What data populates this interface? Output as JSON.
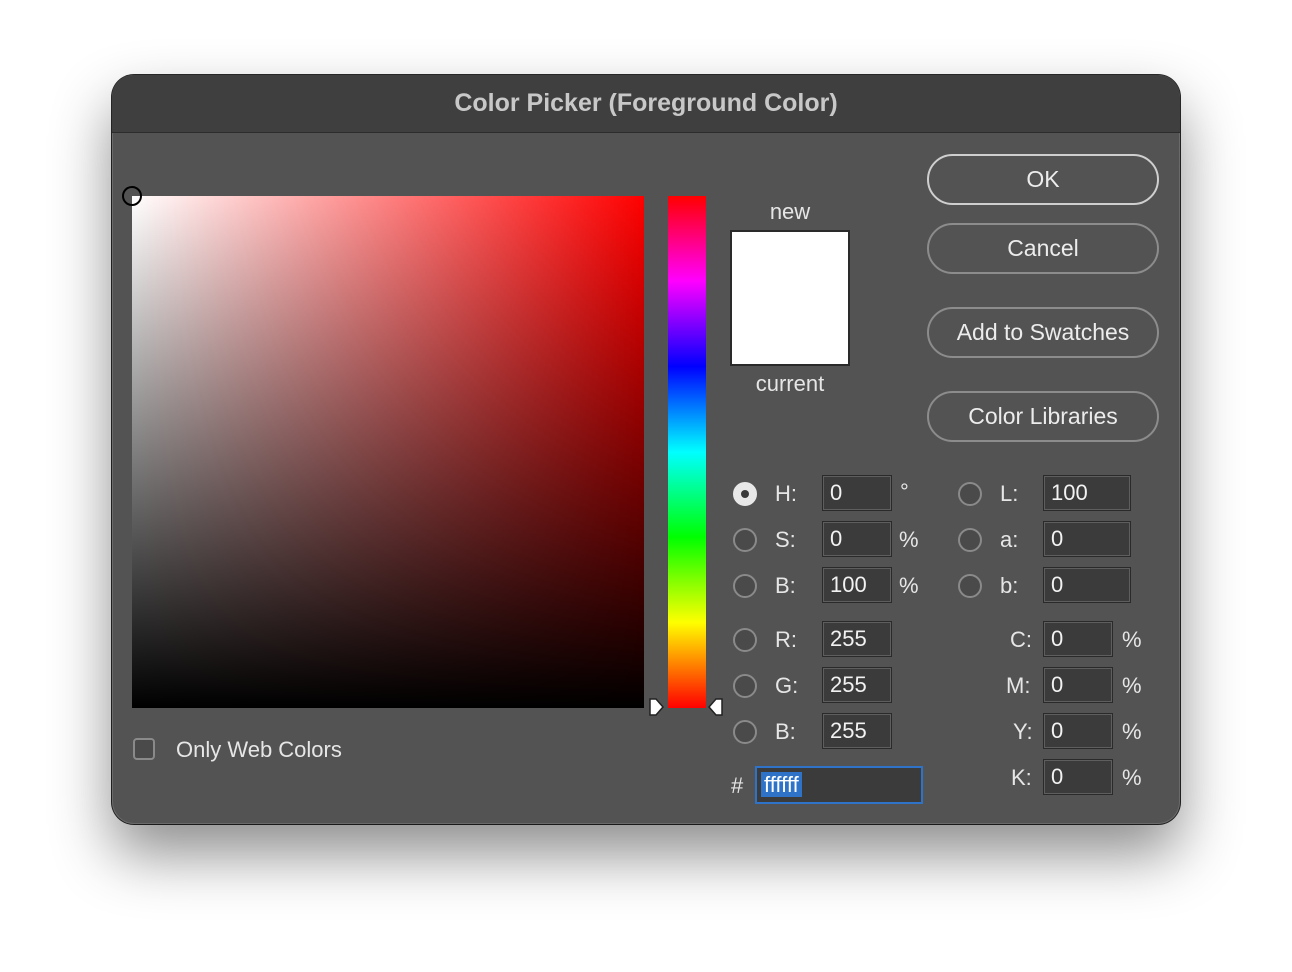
{
  "dialog": {
    "title": "Color Picker (Foreground Color)"
  },
  "buttons": {
    "ok": "OK",
    "cancel": "Cancel",
    "add_to_swatches": "Add to Swatches",
    "color_libraries": "Color Libraries"
  },
  "swatch": {
    "new_label": "new",
    "current_label": "current",
    "new_color": "#ffffff",
    "current_color": "#ffffff"
  },
  "hsb": {
    "h_label": "H:",
    "h_value": "0",
    "h_unit": "°",
    "s_label": "S:",
    "s_value": "0",
    "s_unit": "%",
    "b_label": "B:",
    "b_value": "100",
    "b_unit": "%",
    "selected": "H"
  },
  "rgb": {
    "r_label": "R:",
    "r_value": "255",
    "g_label": "G:",
    "g_value": "255",
    "b_label": "B:",
    "b_value": "255"
  },
  "lab": {
    "l_label": "L:",
    "l_value": "100",
    "a_label": "a:",
    "a_value": "0",
    "b_label": "b:",
    "b_value": "0"
  },
  "cmyk": {
    "c_label": "C:",
    "c_value": "0",
    "c_unit": "%",
    "m_label": "M:",
    "m_value": "0",
    "m_unit": "%",
    "y_label": "Y:",
    "y_value": "0",
    "y_unit": "%",
    "k_label": "K:",
    "k_value": "0",
    "k_unit": "%"
  },
  "hex": {
    "prefix": "#",
    "value": "ffffff"
  },
  "options": {
    "only_web_colors": "Only Web Colors",
    "only_web_colors_checked": false
  },
  "colors": {
    "selection_blue": "#2f73c9",
    "hue_base": "#ff0000"
  }
}
